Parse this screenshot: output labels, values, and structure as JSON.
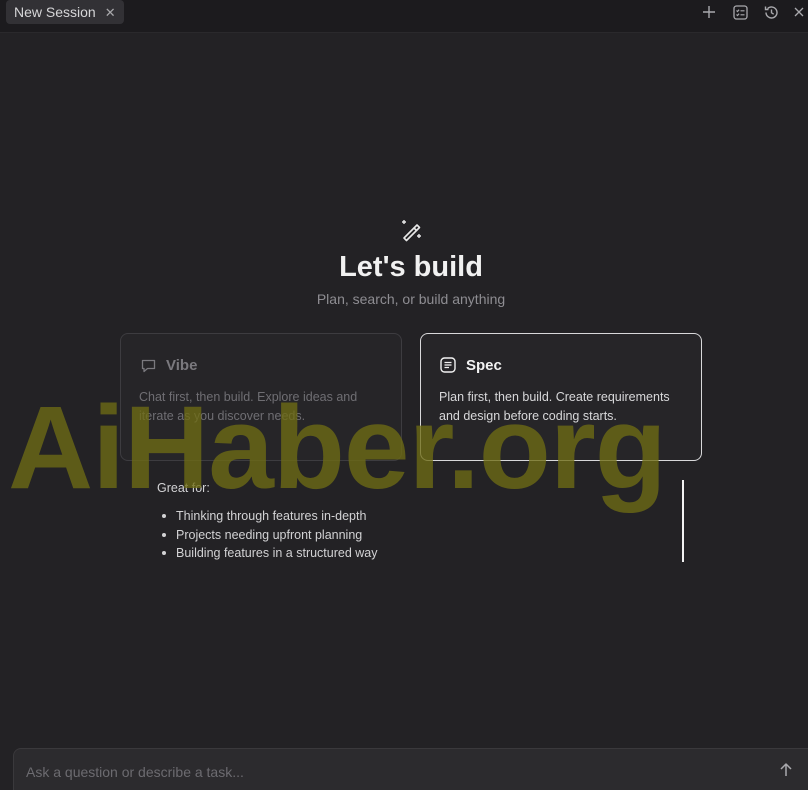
{
  "tabs": [
    {
      "label": "New Session",
      "close_icon": "close-icon"
    }
  ],
  "toolbar": {
    "icons": [
      "plus-icon",
      "checklist-icon",
      "history-icon",
      "close-icon"
    ]
  },
  "hero": {
    "icon": "magic-wand-icon",
    "title": "Let's build",
    "subtitle": "Plan, search, or build anything"
  },
  "modes": [
    {
      "icon": "chat-bubble-icon",
      "title": "Vibe",
      "description": "Chat first, then build. Explore ideas and iterate as you discover needs.",
      "selected": false
    },
    {
      "icon": "document-icon",
      "title": "Spec",
      "description": "Plan first, then build. Create requirements and design before coding starts.",
      "selected": true
    }
  ],
  "great_for": {
    "heading": "Great for:",
    "items": [
      "Thinking through features in-depth",
      "Projects needing upfront planning",
      "Building features in a structured way"
    ]
  },
  "prompt": {
    "placeholder": "Ask a question or describe a task...",
    "value": "",
    "send_icon": "arrow-up-icon"
  },
  "watermark": "AiHaber.org",
  "colors": {
    "background": "#232225",
    "selected_border": "#d8d8da",
    "watermark": "#6e6c14"
  }
}
